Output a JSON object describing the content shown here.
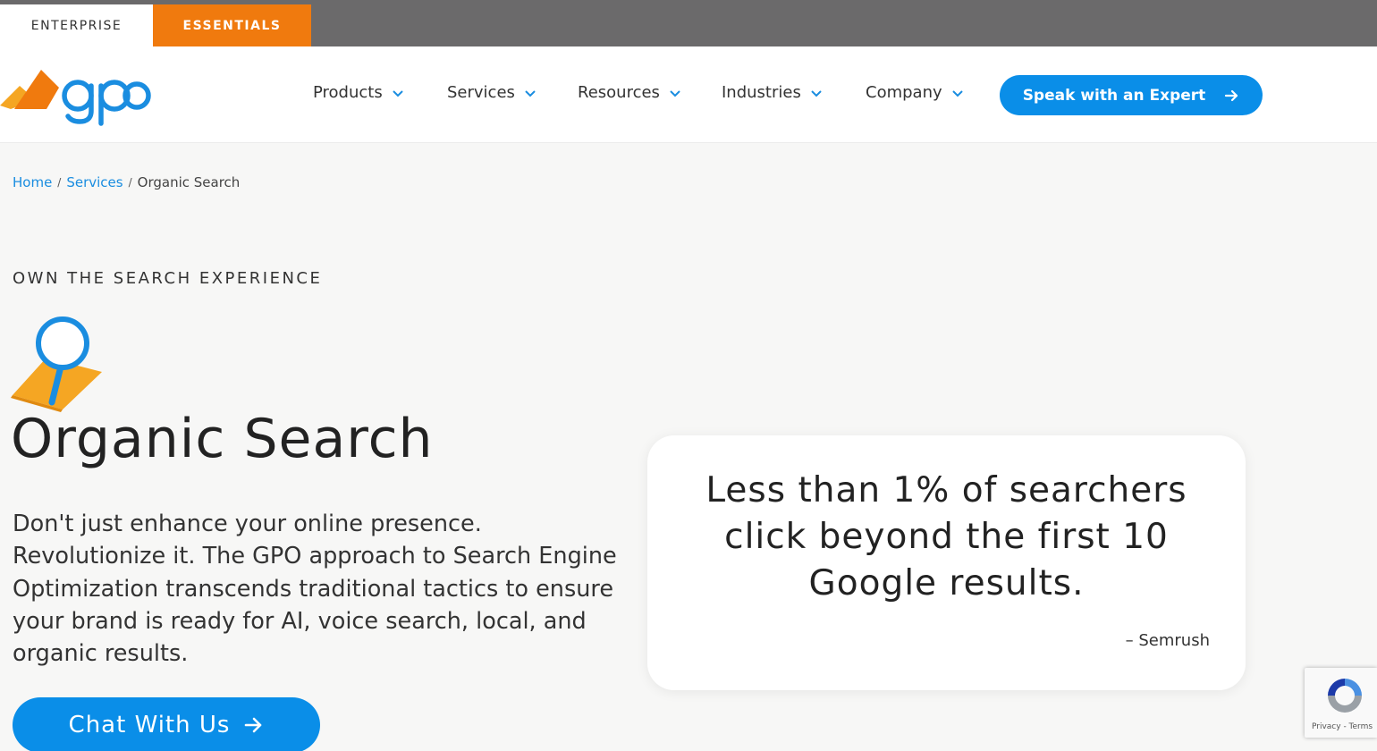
{
  "topbar": {
    "tabs": [
      {
        "label": "ENTERPRISE"
      },
      {
        "label": "ESSENTIALS"
      }
    ]
  },
  "header": {
    "logo_text": "gpo",
    "nav": [
      {
        "label": "Products"
      },
      {
        "label": "Services"
      },
      {
        "label": "Resources"
      },
      {
        "label": "Industries"
      },
      {
        "label": "Company"
      }
    ],
    "cta_label": "Speak with an Expert"
  },
  "breadcrumb": {
    "items": [
      "Home",
      "Services",
      "Organic Search"
    ],
    "separator": "/"
  },
  "hero": {
    "eyebrow": "OWN THE SEARCH EXPERIENCE",
    "title": "Organic Search",
    "body": "Don't just enhance your online presence. Revolutionize it. The GPO approach to Search Engine Optimization transcends traditional tactics to ensure your brand is ready for AI, voice search, local, and organic results.",
    "button_label": "Chat With Us"
  },
  "quote": {
    "text": "Less than 1% of searchers click beyond the first 10 Google results.",
    "source": "– Semrush"
  },
  "recaptcha": {
    "links": "Privacy - Terms"
  },
  "colors": {
    "brand_blue": "#0a8ee8",
    "brand_orange": "#f07a0e",
    "topbar_gray": "#6b6a6b"
  }
}
